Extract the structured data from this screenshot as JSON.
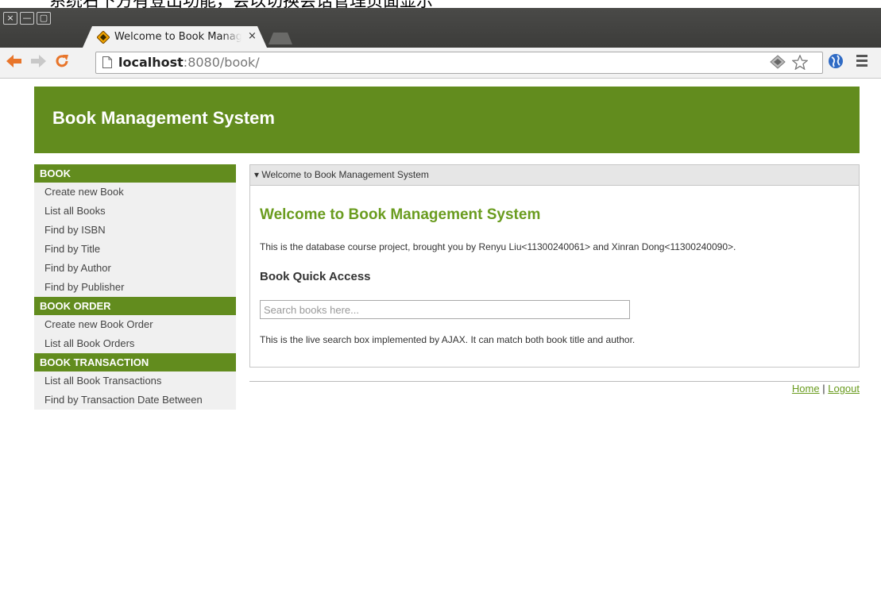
{
  "caption": {
    "text": "系统右下方有登出功能，会以切换会话管理页面显示"
  },
  "window": {
    "close_symbol": "×",
    "minimize_symbol": "—",
    "maximize_symbol": "▢"
  },
  "tab": {
    "title": "Welcome to Book Management System",
    "close_symbol": "×"
  },
  "toolbar": {
    "back_symbol": "🡐",
    "forward_symbol": "➜",
    "reload_symbol": "C",
    "url_host": "localhost",
    "url_rest": ":8080/book/"
  },
  "header": {
    "title": "Book Management System"
  },
  "sidebar": {
    "groups": [
      {
        "title": "BOOK",
        "items": [
          "Create new Book",
          "List all Books",
          "Find by ISBN",
          "Find by Title",
          "Find by Author",
          "Find by Publisher"
        ]
      },
      {
        "title": "BOOK ORDER",
        "items": [
          "Create new Book Order",
          "List all Book Orders"
        ]
      },
      {
        "title": "BOOK TRANSACTION",
        "items": [
          "List all Book Transactions",
          "Find by Transaction Date Between"
        ]
      }
    ]
  },
  "panel": {
    "header": "▾ Welcome to Book Management System",
    "welcome_title": "Welcome to Book Management System",
    "description": "This is the database course project, brought you by Renyu Liu<11300240061> and Xinran Dong<11300240090>.",
    "quick_access_title": "Book Quick Access",
    "search_placeholder": "Search books here...",
    "live_search_note": "This is the live search box implemented by AJAX. It can match both book title and author."
  },
  "footer": {
    "home_label": "Home",
    "separator": "|",
    "logout_label": "Logout"
  },
  "colors": {
    "brand_green": "#628c1e",
    "accent_green": "#6a9c1f"
  }
}
